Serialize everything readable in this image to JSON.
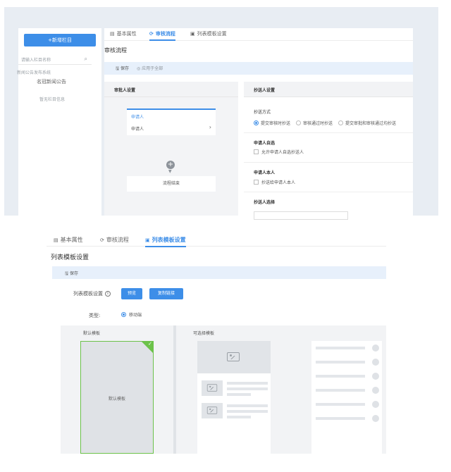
{
  "top": {
    "sidebar": {
      "add_button": "+新增栏目",
      "search_placeholder": "请输入栏目名称",
      "tree_root": "新闻公告发布系统",
      "tree_child": "名冠新闻公告",
      "empty_text": "暂无栏目信息"
    },
    "tabs": [
      {
        "label": "基本属性",
        "icon": "list-icon"
      },
      {
        "label": "审核流程",
        "icon": "refresh-icon"
      },
      {
        "label": "列表模板设置",
        "icon": "image-icon"
      }
    ],
    "title": "审核流程",
    "toolbar": {
      "save": "保存",
      "apply_all": "应用于全部"
    },
    "approver": {
      "header": "审批人设置",
      "node1": "申请人",
      "node2": "申请人",
      "end": "流程结束"
    },
    "cc": {
      "header": "抄送人设置",
      "mode_label": "抄送方式",
      "options": [
        "提交审核时抄送",
        "审核通过时抄送",
        "提交审批和审核通过均抄送"
      ],
      "self_select_label": "申请人自选",
      "self_select_option": "允许申请人自选抄送人",
      "self_label": "申请人本人",
      "self_option": "抄送给申请人本人",
      "choose_label": "抄送人选择"
    }
  },
  "bottom": {
    "tabs": [
      {
        "label": "基本属性",
        "icon": "list-icon"
      },
      {
        "label": "审核流程",
        "icon": "refresh-icon"
      },
      {
        "label": "列表模板设置",
        "icon": "image-icon"
      }
    ],
    "title": "列表模板设置",
    "toolbar": {
      "save": "保存"
    },
    "config_label": "列表模板设置",
    "preview_button": "预览",
    "copy_link_button": "复制链接",
    "type_label": "类型:",
    "type_value": "移动端",
    "default_template": "默认模板",
    "default_card_label": "默认模板",
    "optional_template": "可选择模板"
  },
  "colors": {
    "primary": "#3d8ee8",
    "selected_border": "#6cc24a"
  }
}
